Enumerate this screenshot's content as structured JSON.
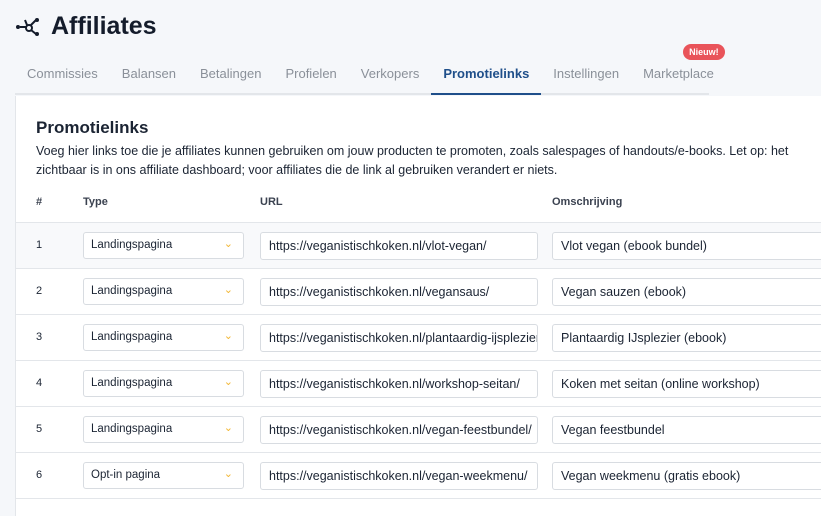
{
  "header": {
    "title": "Affiliates",
    "icon": "network-icon"
  },
  "tabs": [
    {
      "label": "Commissies"
    },
    {
      "label": "Balansen"
    },
    {
      "label": "Betalingen"
    },
    {
      "label": "Profielen"
    },
    {
      "label": "Verkopers"
    },
    {
      "label": "Promotielinks",
      "active": true
    },
    {
      "label": "Instellingen"
    },
    {
      "label": "Marketplace",
      "badge": "Nieuw!"
    }
  ],
  "card": {
    "title": "Promotielinks",
    "description_line1": "Voeg hier links toe die je affiliates kunnen gebruiken om jouw producten te promoten, zoals salespages of handouts/e-books. Let op: het",
    "description_line2": "zichtbaar is in ons affiliate dashboard; voor affiliates die de link al gebruiken verandert er niets.",
    "columns": {
      "num": "#",
      "type": "Type",
      "url": "URL",
      "desc": "Omschrijving"
    },
    "rows": [
      {
        "num": "1",
        "type": "Landingspagina",
        "url": "https://veganistischkoken.nl/vlot-vegan/",
        "desc": "Vlot vegan (ebook bundel)"
      },
      {
        "num": "2",
        "type": "Landingspagina",
        "url": "https://veganistischkoken.nl/vegansaus/",
        "desc": "Vegan sauzen (ebook)"
      },
      {
        "num": "3",
        "type": "Landingspagina",
        "url": "https://veganistischkoken.nl/plantaardig-ijsplezier/",
        "desc": "Plantaardig IJsplezier (ebook)"
      },
      {
        "num": "4",
        "type": "Landingspagina",
        "url": "https://veganistischkoken.nl/workshop-seitan/",
        "desc": "Koken met seitan (online workshop)"
      },
      {
        "num": "5",
        "type": "Landingspagina",
        "url": "https://veganistischkoken.nl/vegan-feestbundel/",
        "desc": "Vegan feestbundel"
      },
      {
        "num": "6",
        "type": "Opt-in pagina",
        "url": "https://veganistischkoken.nl/vegan-weekmenu/",
        "desc": "Vegan weekmenu (gratis ebook)"
      }
    ]
  },
  "colors": {
    "accent": "#1f4f8a",
    "badge": "#e9545a",
    "chevron": "#f2b632"
  }
}
